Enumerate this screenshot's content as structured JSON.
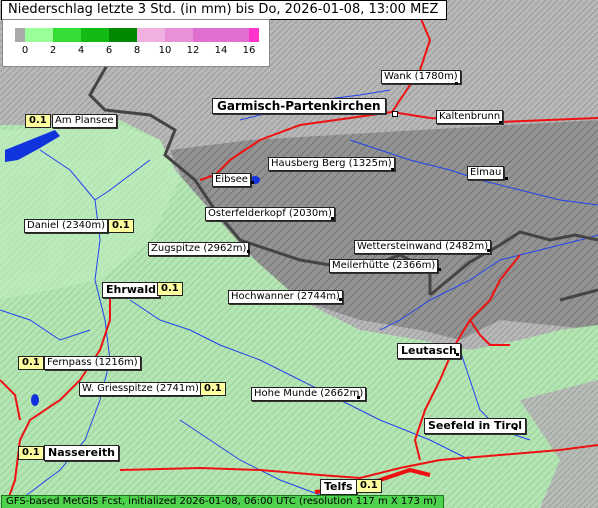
{
  "title": "Niederschlag letzte 3 Std. (in mm) bis Do, 2026-01-08, 13:00 MEZ",
  "legend": {
    "ticks": [
      "0",
      "2",
      "4",
      "6",
      "8",
      "10",
      "12",
      "14",
      "16"
    ],
    "colors": [
      "#aaaaaa",
      "#99ff99",
      "#33dd33",
      "#11bb11",
      "#008800",
      "#f0b0e0",
      "#e890d8",
      "#e070d0",
      "#ff33cc"
    ]
  },
  "places": [
    {
      "name": "Wank (1780m)",
      "style": "small"
    },
    {
      "name": "Garmisch-Partenkirchen",
      "style": "huge"
    },
    {
      "name": "Kaltenbrunn",
      "style": "small"
    },
    {
      "name": "Am Plansee",
      "style": "small",
      "value": "0.1"
    },
    {
      "name": "Hausberg Berg (1325m)",
      "style": "small"
    },
    {
      "name": "Eibsee",
      "style": "small"
    },
    {
      "name": "Elmau",
      "style": "small"
    },
    {
      "name": "Osterfelderkopf (2030m)",
      "style": "small"
    },
    {
      "name": "Daniel (2340m)",
      "style": "small",
      "value": "0.1"
    },
    {
      "name": "Zugspitze (2962m)",
      "style": "small"
    },
    {
      "name": "Wettersteinwand (2482m)",
      "style": "small"
    },
    {
      "name": "Meilerhütte (2366m)",
      "style": "small"
    },
    {
      "name": "Ehrwald",
      "style": "big",
      "value": "0.1"
    },
    {
      "name": "Hochwanner (2744m)",
      "style": "small"
    },
    {
      "name": "Leutasch",
      "style": "big"
    },
    {
      "name": "Fernpass (1216m)",
      "style": "small",
      "value": "0.1"
    },
    {
      "name": "W. Griesspitze (2741m)",
      "style": "small",
      "value": "0.1"
    },
    {
      "name": "Hohe Munde (2662m)",
      "style": "small"
    },
    {
      "name": "Seefeld in Tirol",
      "style": "big"
    },
    {
      "name": "Nassereith",
      "style": "big",
      "value": "0.1"
    },
    {
      "name": "Telfs",
      "style": "big",
      "value": "0.1"
    }
  ],
  "footer": "GFS-based MetGIS Fcst, initialized 2026-01-08, 06:00 UTC  (resolution 117 m X 173 m)"
}
